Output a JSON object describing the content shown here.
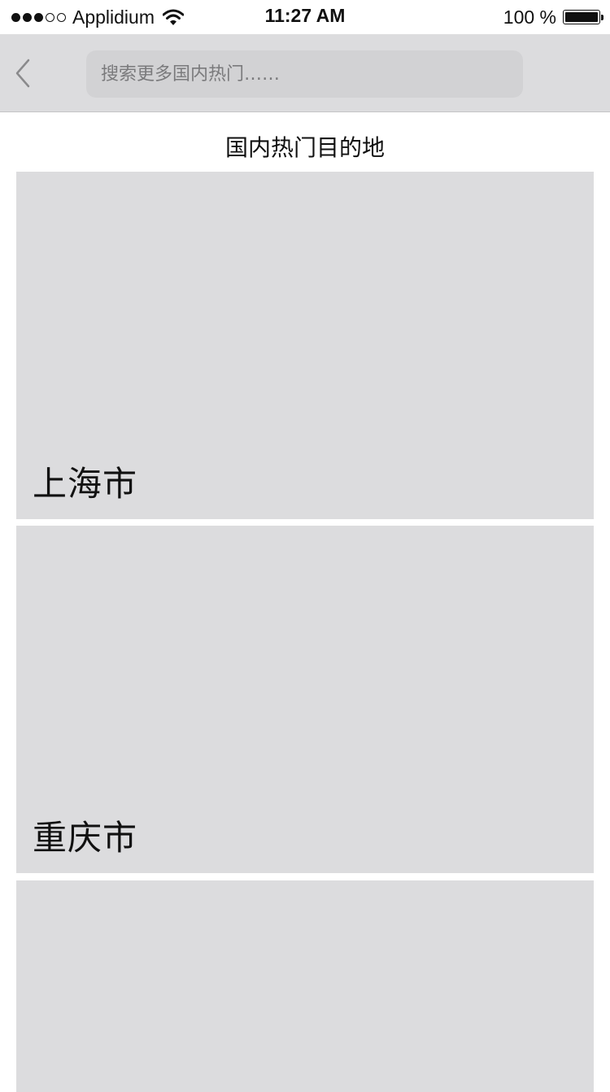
{
  "status_bar": {
    "carrier": "Applidium",
    "time": "11:27 AM",
    "battery": "100 %"
  },
  "nav": {
    "back_icon": "chevron-left-icon",
    "search_placeholder": "搜索更多国内热门……"
  },
  "section": {
    "title": "国内热门目的地"
  },
  "destinations": [
    {
      "name": "上海市"
    },
    {
      "name": "重庆市"
    },
    {
      "name": ""
    }
  ]
}
